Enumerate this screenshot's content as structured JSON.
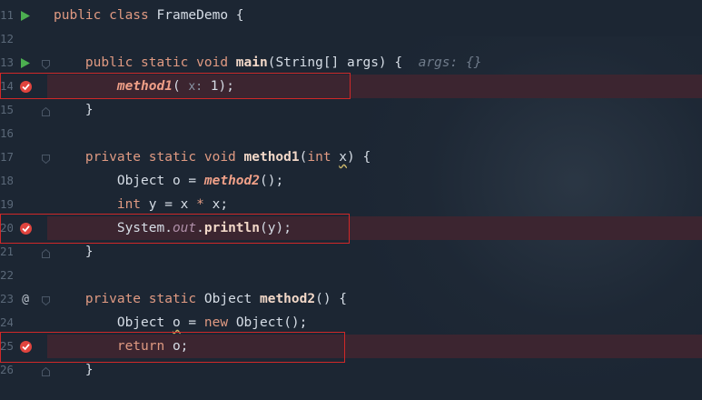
{
  "editor": {
    "lines": [
      {
        "num": "11",
        "tokens": [
          {
            "t": "public class ",
            "c": "kw"
          },
          {
            "t": "FrameDemo {",
            "c": ""
          }
        ]
      },
      {
        "num": "12",
        "tokens": []
      },
      {
        "num": "13",
        "tokens": [
          {
            "t": "    public static void ",
            "c": "kw"
          },
          {
            "t": "main",
            "c": "fn"
          },
          {
            "t": "(String[] args) {  ",
            "c": ""
          },
          {
            "t": "args: {}",
            "c": "inlay"
          }
        ]
      },
      {
        "num": "14",
        "tokens": [
          {
            "t": "        ",
            "c": ""
          },
          {
            "t": "method1",
            "c": "fni"
          },
          {
            "t": "( ",
            "c": ""
          },
          {
            "t": "x:",
            "c": "hint"
          },
          {
            "t": " 1);",
            "c": ""
          }
        ]
      },
      {
        "num": "15",
        "tokens": [
          {
            "t": "    }",
            "c": ""
          }
        ]
      },
      {
        "num": "16",
        "tokens": []
      },
      {
        "num": "17",
        "tokens": [
          {
            "t": "    private static void ",
            "c": "kw"
          },
          {
            "t": "method1",
            "c": "fn"
          },
          {
            "t": "(",
            "c": ""
          },
          {
            "t": "int ",
            "c": "kw"
          },
          {
            "t": "x",
            "c": "warn"
          },
          {
            "t": ") {",
            "c": ""
          }
        ]
      },
      {
        "num": "18",
        "tokens": [
          {
            "t": "        Object o = ",
            "c": ""
          },
          {
            "t": "method2",
            "c": "fni"
          },
          {
            "t": "();",
            "c": ""
          }
        ]
      },
      {
        "num": "19",
        "tokens": [
          {
            "t": "        ",
            "c": ""
          },
          {
            "t": "int ",
            "c": "kw"
          },
          {
            "t": "y = x ",
            "c": ""
          },
          {
            "t": "*",
            "c": "kw"
          },
          {
            "t": " x;",
            "c": ""
          }
        ]
      },
      {
        "num": "20",
        "tokens": [
          {
            "t": "        System.",
            "c": ""
          },
          {
            "t": "out",
            "c": "st"
          },
          {
            "t": ".",
            "c": ""
          },
          {
            "t": "println",
            "c": "fn"
          },
          {
            "t": "(y);",
            "c": ""
          }
        ]
      },
      {
        "num": "21",
        "tokens": [
          {
            "t": "    }",
            "c": ""
          }
        ]
      },
      {
        "num": "22",
        "tokens": []
      },
      {
        "num": "23",
        "tokens": [
          {
            "t": "    private static ",
            "c": "kw"
          },
          {
            "t": "Object ",
            "c": ""
          },
          {
            "t": "method2",
            "c": "fn"
          },
          {
            "t": "() {",
            "c": ""
          }
        ]
      },
      {
        "num": "24",
        "tokens": [
          {
            "t": "        Object ",
            "c": ""
          },
          {
            "t": "o",
            "c": "warn"
          },
          {
            "t": " = ",
            "c": ""
          },
          {
            "t": "new ",
            "c": "kw"
          },
          {
            "t": "Object();",
            "c": ""
          }
        ]
      },
      {
        "num": "25",
        "tokens": [
          {
            "t": "        ",
            "c": ""
          },
          {
            "t": "return ",
            "c": "kw"
          },
          {
            "t": "o;",
            "c": ""
          }
        ]
      },
      {
        "num": "26",
        "tokens": [
          {
            "t": "    }",
            "c": ""
          }
        ]
      }
    ],
    "markers": {
      "11": "run-icon",
      "13": "run-icon",
      "14": "breakpoint-icon",
      "20": "breakpoint-icon",
      "23": "override-icon",
      "25": "breakpoint-icon"
    },
    "override_symbol": "@",
    "breakpoint_lines": [
      "14",
      "20",
      "25"
    ],
    "colors": {
      "background": "#1c2633",
      "keyword": "#e09a82",
      "breakpoint": "#e0443e",
      "run": "#4caf50",
      "highlight_box": "#d02828"
    }
  }
}
